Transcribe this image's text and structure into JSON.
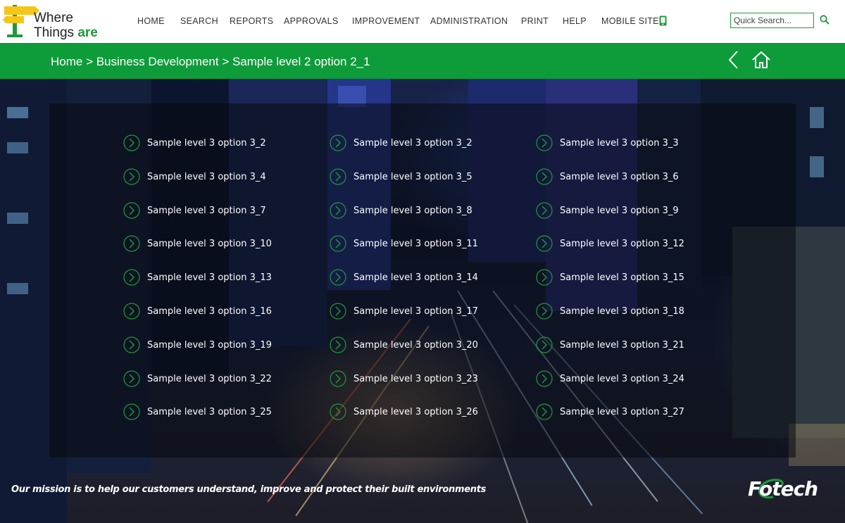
{
  "logo": {
    "line1": "Where",
    "line2": "Things ",
    "line2_accent": "are"
  },
  "nav": [
    {
      "label": "HOME"
    },
    {
      "label": "SEARCH"
    },
    {
      "label": "REPORTS"
    },
    {
      "label": "APPROVALS"
    },
    {
      "label": "IMPROVEMENT"
    },
    {
      "label": "ADMINISTRATION"
    },
    {
      "label": "PRINT"
    },
    {
      "label": "HELP"
    },
    {
      "label": "MOBILE SITE"
    }
  ],
  "search": {
    "placeholder": "Quick Search..."
  },
  "breadcrumb": "Home > Business Development > Sample level 2 option 2_1",
  "options": [
    "Sample level 3 option 3_2",
    "Sample level 3 option 3_2",
    "Sample level 3 option 3_3",
    "Sample level 3 option 3_4",
    "Sample level 3 option 3_5",
    "Sample level 3 option 3_6",
    "Sample level 3 option 3_7",
    "Sample level 3 option 3_8",
    "Sample level 3 option 3_9",
    "Sample level 3 option 3_10",
    "Sample level 3 option 3_11",
    "Sample level 3 option 3_12",
    "Sample level 3 option 3_13",
    "Sample level 3 option 3_14",
    "Sample level 3 option 3_15",
    "Sample level 3 option 3_16",
    "Sample level 3 option 3_17",
    "Sample level 3 option 3_18",
    "Sample level 3 option 3_19",
    "Sample level 3 option 3_20",
    "Sample level 3 option 3_21",
    "Sample level 3 option 3_22",
    "Sample level 3 option 3_23",
    "Sample level 3 option 3_24",
    "Sample level 3 option 3_25",
    "Sample level 3 option 3_26",
    "Sample level 3 option 3_27"
  ],
  "footer": {
    "mission": "Our mission is to help our customers understand, improve and protect their built environments",
    "brand": "Fotech"
  },
  "colors": {
    "accent": "#0e9b3a",
    "logo_yellow": "#f5c518"
  },
  "icons": {
    "mobile": "mobile-phone-icon",
    "search": "search-icon",
    "back": "chevron-left-icon",
    "home": "home-icon",
    "option": "circle-arrow-right-icon"
  }
}
